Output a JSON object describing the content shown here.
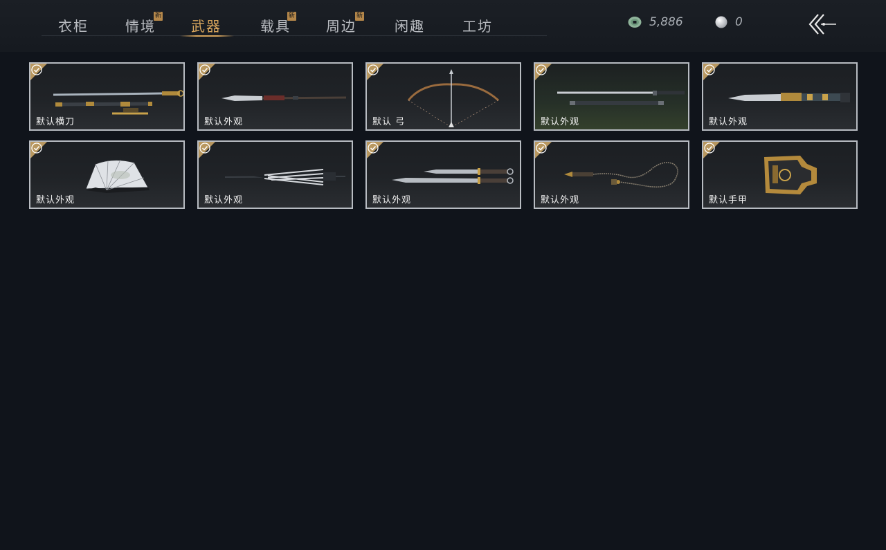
{
  "tabs": [
    {
      "label": "衣柜",
      "new": false,
      "active": false
    },
    {
      "label": "情境",
      "new": true,
      "active": false
    },
    {
      "label": "武器",
      "new": false,
      "active": true
    },
    {
      "label": "载具",
      "new": true,
      "active": false
    },
    {
      "label": "周边",
      "new": true,
      "active": false
    },
    {
      "label": "闲趣",
      "new": false,
      "active": false
    },
    {
      "label": "工坊",
      "new": false,
      "active": false
    }
  ],
  "new_badge_text": "新",
  "currency": {
    "jade_amount": "5,886",
    "pearl_amount": "0"
  },
  "icons": {
    "jade": "jade-coin-icon",
    "pearl": "pearl-icon",
    "back": "back-arrow-icon",
    "check": "equipped-check-icon"
  },
  "colors": {
    "accent_gold": "#d6a45c",
    "badge": "#b4874a",
    "card_border": "#b8bcc2",
    "background": "#10141b"
  },
  "items": [
    {
      "label": "默认横刀",
      "weapon": "sword-with-scabbard",
      "equipped": true
    },
    {
      "label": "默认外观",
      "weapon": "spear",
      "equipped": true
    },
    {
      "label": "默认 弓",
      "weapon": "bow",
      "equipped": true
    },
    {
      "label": "默认外观",
      "weapon": "long-sword",
      "equipped": true
    },
    {
      "label": "默认外观",
      "weapon": "ornate-blade",
      "equipped": true
    },
    {
      "label": "默认外观",
      "weapon": "fan",
      "equipped": true
    },
    {
      "label": "默认外观",
      "weapon": "umbrella",
      "equipped": true
    },
    {
      "label": "默认外观",
      "weapon": "twin-swords",
      "equipped": true
    },
    {
      "label": "默认外观",
      "weapon": "rope-dart",
      "equipped": true
    },
    {
      "label": "默认手甲",
      "weapon": "gauntlet",
      "equipped": true
    }
  ]
}
